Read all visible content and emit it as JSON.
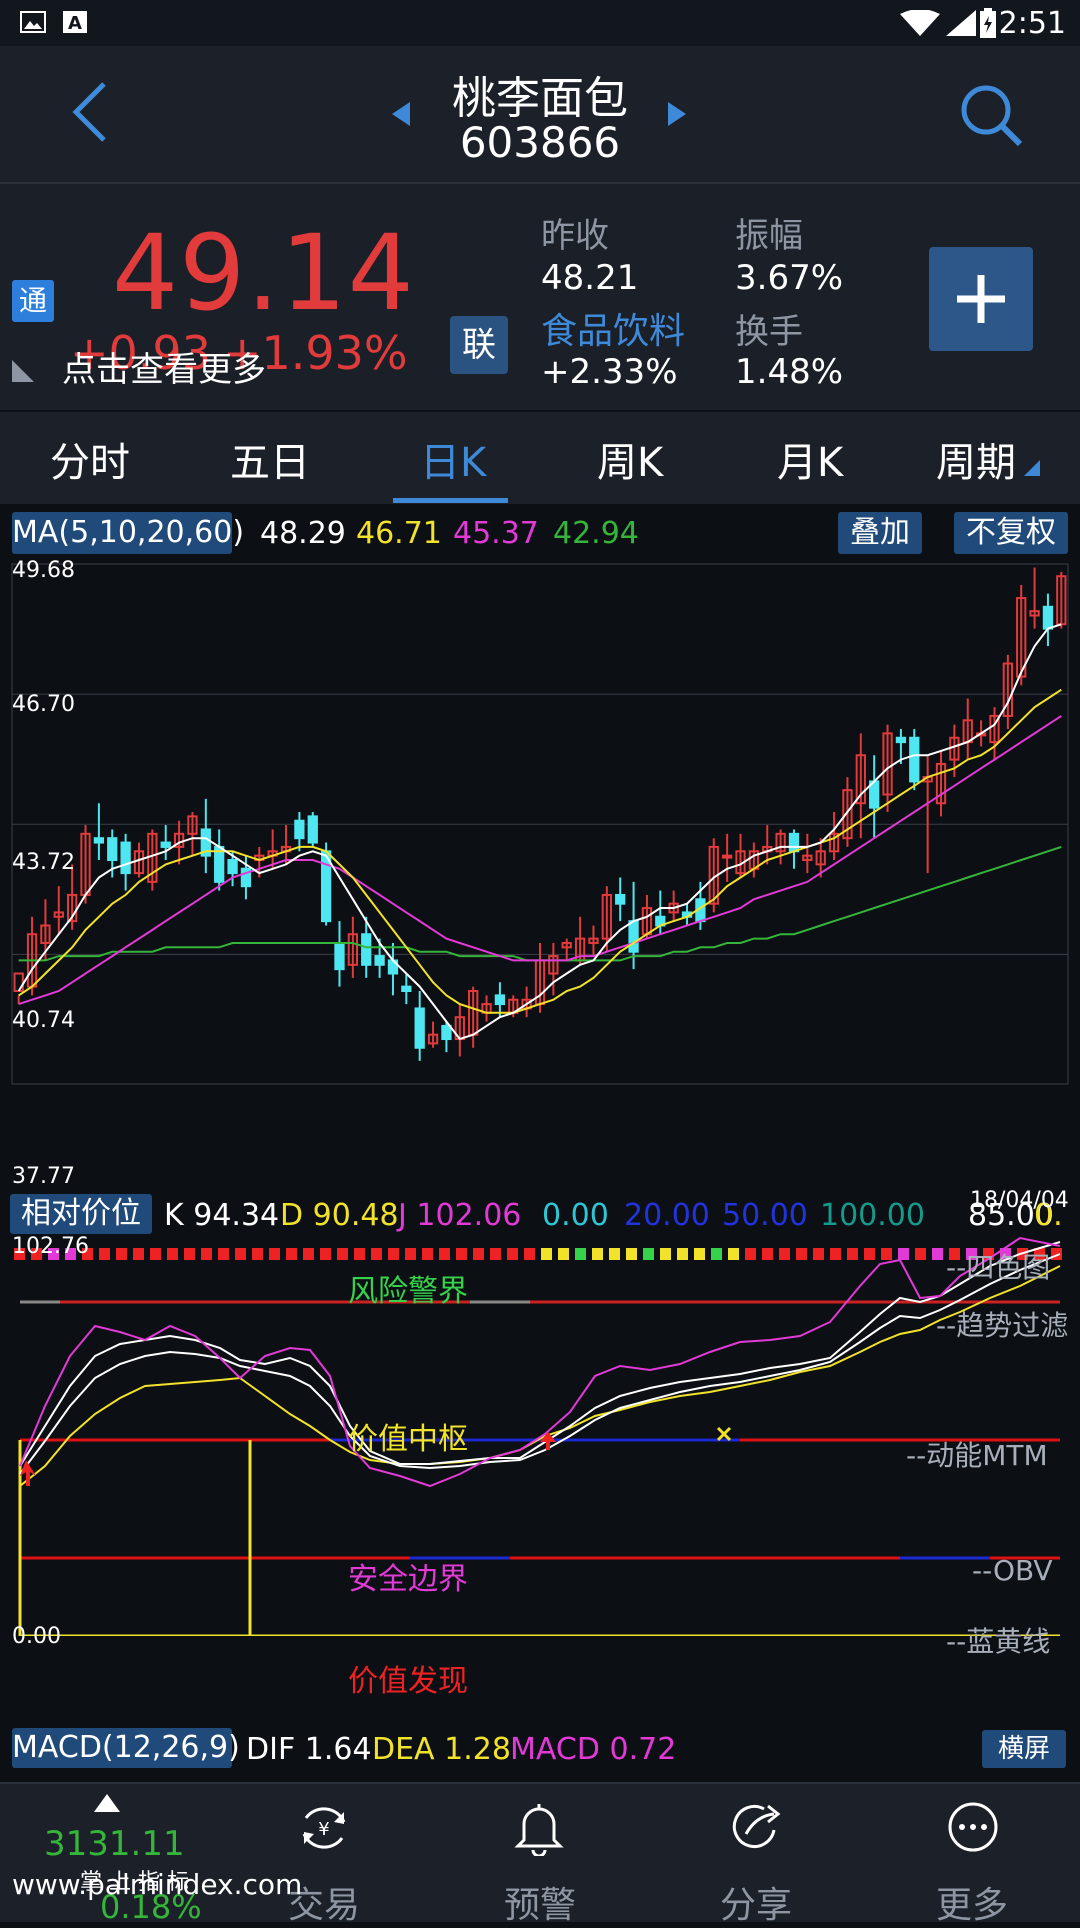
{
  "status": {
    "time": "2:51"
  },
  "header": {
    "title": "桃李面包",
    "code": "603866"
  },
  "quote": {
    "price": "49.14",
    "change": "+0.93",
    "change_pct": "+1.93%",
    "more_label": "点击查看更多",
    "tong_badge": "通",
    "lian_badge": "联",
    "prev_close_label": "昨收",
    "prev_close": "48.21",
    "sector_name": "食品饮料",
    "sector_change": "+2.33%",
    "amplitude_label": "振幅",
    "amplitude": "3.67%",
    "turnover_label": "换手",
    "turnover": "1.48%"
  },
  "tabs": [
    "分时",
    "五日",
    "日K",
    "周K",
    "月K",
    "周期"
  ],
  "active_tab": "日K",
  "ma": {
    "label": "MA(5,10,20,60)",
    "v5": "48.29",
    "v10": "46.71",
    "v20": "45.37",
    "v60": "42.94",
    "overlay_label": "叠加",
    "adjust_label": "不复权"
  },
  "price_axis": [
    "49.68",
    "46.70",
    "43.72",
    "40.74",
    "37.77"
  ],
  "indicator": {
    "name": "相对价位",
    "k_label": "K",
    "k": "94.34",
    "d_label": "D",
    "d": "90.48",
    "j_label": "J",
    "j": "102.06",
    "levels": [
      "0.00",
      "20.00",
      "50.00",
      "100.00",
      "85.00",
      "0."
    ],
    "date": "18/04/04",
    "top_value": "102.76",
    "bottom_value": "0.00",
    "zone_risk": "风险警界",
    "zone_center": "价值中枢",
    "zone_safe": "安全边界",
    "zone_discover": "价值发现",
    "r_sise": "--四色图",
    "r_trend": "--趋势过滤",
    "r_mtm": "--动能MTM",
    "r_obv": "--OBV",
    "r_lanhuang": "--蓝黄线"
  },
  "macd": {
    "label": "MACD(12,26,9)",
    "dif_label": "DIF",
    "dif": "1.64",
    "dea_label": "DEA",
    "dea": "1.28",
    "macd_label": "MACD",
    "macd": "0.72",
    "landscape_label": "横屏"
  },
  "nav": {
    "index_value": "3131.11",
    "index_pct": "0.18%",
    "index_caption": "掌 上 指 标",
    "trade": "交易",
    "alert": "预警",
    "share": "分享",
    "more": "更多"
  },
  "watermark": "www.palmindex.com",
  "colors": {
    "up": "#e23b3b",
    "down": "#4ee6f0",
    "accent": "#3f8ad8",
    "ma5": "#ffffff",
    "ma10": "#f2e32a",
    "ma20": "#e23ad6",
    "ma60": "#35b53a"
  },
  "chart_data": {
    "type": "candlestick",
    "ylim": [
      37.77,
      49.68
    ],
    "candles": [
      [
        39.9,
        40.3,
        39.8,
        39.6
      ],
      [
        40.0,
        41.2,
        41.6,
        39.8
      ],
      [
        41.0,
        41.4,
        42.0,
        40.6
      ],
      [
        41.6,
        41.7,
        42.3,
        41.2
      ],
      [
        41.5,
        42.1,
        42.8,
        41.3
      ],
      [
        42.1,
        43.5,
        43.7,
        41.9
      ],
      [
        43.4,
        43.3,
        44.2,
        42.9
      ],
      [
        43.4,
        42.9,
        43.6,
        42.5
      ],
      [
        43.3,
        42.6,
        43.5,
        42.2
      ],
      [
        42.6,
        43.1,
        43.3,
        42.5
      ],
      [
        42.4,
        43.5,
        43.6,
        42.2
      ],
      [
        43.3,
        43.2,
        43.7,
        42.9
      ],
      [
        43.2,
        43.5,
        43.8,
        42.8
      ],
      [
        43.5,
        43.9,
        44.0,
        43.0
      ],
      [
        43.6,
        43.0,
        44.3,
        42.6
      ],
      [
        43.2,
        42.4,
        43.6,
        42.2
      ],
      [
        42.9,
        42.6,
        43.1,
        42.3
      ],
      [
        42.7,
        42.3,
        43.0,
        42.0
      ],
      [
        42.9,
        43.0,
        43.2,
        42.5
      ],
      [
        43.0,
        43.1,
        43.6,
        42.7
      ],
      [
        43.1,
        43.2,
        43.7,
        42.8
      ],
      [
        43.8,
        43.4,
        44.0,
        43.1
      ],
      [
        43.9,
        43.3,
        44.0,
        43.2
      ],
      [
        43.1,
        41.5,
        43.3,
        41.4
      ],
      [
        41.0,
        40.4,
        41.5,
        40.0
      ],
      [
        40.5,
        41.2,
        41.6,
        40.2
      ],
      [
        41.2,
        40.5,
        41.6,
        40.2
      ],
      [
        40.7,
        40.5,
        41.1,
        40.2
      ],
      [
        40.6,
        40.3,
        41.0,
        39.8
      ],
      [
        40.0,
        39.9,
        40.3,
        39.6
      ],
      [
        39.5,
        38.6,
        39.9,
        38.3
      ],
      [
        38.7,
        38.9,
        39.2,
        38.6
      ],
      [
        39.1,
        38.8,
        39.2,
        38.5
      ],
      [
        38.8,
        39.3,
        39.6,
        38.4
      ],
      [
        38.9,
        39.9,
        40.0,
        38.6
      ],
      [
        39.4,
        39.6,
        39.8,
        39.2
      ],
      [
        39.8,
        39.6,
        40.1,
        39.3
      ],
      [
        39.4,
        39.7,
        39.8,
        39.3
      ],
      [
        39.5,
        39.7,
        40.0,
        39.3
      ],
      [
        39.6,
        40.6,
        41.0,
        39.4
      ],
      [
        40.3,
        40.7,
        41.0,
        39.8
      ],
      [
        40.9,
        41.0,
        41.1,
        40.6
      ],
      [
        40.6,
        41.1,
        41.6,
        40.5
      ],
      [
        41.0,
        41.1,
        41.4,
        40.7
      ],
      [
        41.1,
        42.1,
        42.3,
        40.8
      ],
      [
        42.1,
        41.9,
        42.5,
        41.5
      ],
      [
        41.5,
        40.8,
        42.4,
        40.4
      ],
      [
        41.2,
        41.8,
        42.1,
        41.1
      ],
      [
        41.6,
        41.4,
        42.2,
        41.2
      ],
      [
        41.7,
        41.9,
        42.2,
        41.5
      ],
      [
        41.7,
        41.6,
        41.9,
        41.4
      ],
      [
        42.0,
        41.5,
        42.4,
        41.3
      ],
      [
        41.9,
        43.2,
        43.4,
        41.7
      ],
      [
        43.0,
        43.0,
        43.5,
        42.4
      ],
      [
        42.6,
        43.1,
        43.5,
        42.5
      ],
      [
        42.7,
        43.1,
        43.3,
        42.5
      ],
      [
        43.1,
        43.2,
        43.7,
        42.8
      ],
      [
        43.1,
        43.5,
        43.6,
        42.8
      ],
      [
        43.5,
        43.1,
        43.6,
        42.7
      ],
      [
        42.9,
        43.0,
        43.5,
        42.6
      ],
      [
        42.8,
        43.1,
        43.4,
        42.5
      ],
      [
        43.1,
        43.5,
        44.0,
        42.9
      ],
      [
        43.4,
        44.5,
        44.8,
        43.2
      ],
      [
        44.2,
        45.3,
        45.8,
        43.4
      ],
      [
        44.7,
        44.1,
        45.3,
        43.4
      ],
      [
        44.4,
        45.8,
        46.0,
        44.0
      ],
      [
        45.7,
        45.6,
        45.9,
        45.1
      ],
      [
        45.7,
        44.7,
        45.9,
        44.5
      ],
      [
        44.7,
        44.8,
        45.3,
        42.6
      ],
      [
        44.2,
        45.1,
        45.4,
        43.9
      ],
      [
        45.2,
        45.7,
        46.0,
        44.8
      ],
      [
        45.6,
        46.1,
        46.6,
        45.2
      ],
      [
        45.8,
        45.8,
        46.1,
        45.5
      ],
      [
        45.6,
        46.2,
        46.4,
        45.2
      ],
      [
        46.2,
        47.4,
        47.6,
        45.9
      ],
      [
        47.1,
        48.9,
        49.2,
        46.9
      ],
      [
        48.5,
        48.6,
        49.6,
        48.2
      ],
      [
        48.7,
        48.2,
        49.0,
        47.8
      ],
      [
        48.3,
        49.4,
        49.5,
        48.2
      ]
    ],
    "ma5": [
      39.9,
      40.4,
      40.8,
      41.2,
      41.6,
      42.1,
      42.5,
      42.7,
      42.8,
      42.9,
      43.0,
      43.1,
      43.3,
      43.4,
      43.4,
      43.2,
      43.0,
      42.8,
      42.6,
      42.7,
      42.8,
      43.0,
      43.1,
      43.0,
      42.5,
      42.0,
      41.5,
      41.0,
      40.6,
      40.3,
      40.0,
      39.6,
      39.2,
      38.8,
      38.9,
      39.1,
      39.3,
      39.4,
      39.6,
      39.8,
      40.1,
      40.3,
      40.5,
      40.6,
      41.0,
      41.3,
      41.5,
      41.6,
      41.8,
      41.8,
      41.9,
      42.2,
      42.5,
      42.7,
      42.8,
      43.0,
      43.1,
      43.2,
      43.2,
      43.2,
      43.3,
      43.6,
      44.0,
      44.4,
      44.7,
      45.0,
      45.2,
      45.3,
      45.3,
      45.4,
      45.5,
      45.6,
      45.8,
      46.0,
      46.5,
      47.2,
      47.8,
      48.2,
      48.3
    ],
    "ma10": [
      39.8,
      40.0,
      40.3,
      40.6,
      40.9,
      41.3,
      41.6,
      41.9,
      42.1,
      42.4,
      42.6,
      42.8,
      42.9,
      43.0,
      43.1,
      43.1,
      43.1,
      43.0,
      42.9,
      43.0,
      43.1,
      43.2,
      43.2,
      43.1,
      42.8,
      42.5,
      42.1,
      41.7,
      41.3,
      40.9,
      40.5,
      40.1,
      39.8,
      39.6,
      39.5,
      39.4,
      39.4,
      39.4,
      39.5,
      39.6,
      39.7,
      39.9,
      40.0,
      40.2,
      40.5,
      40.8,
      41.0,
      41.2,
      41.4,
      41.5,
      41.6,
      41.8,
      42.0,
      42.3,
      42.5,
      42.7,
      42.9,
      43.0,
      43.1,
      43.2,
      43.3,
      43.4,
      43.6,
      43.8,
      44.0,
      44.2,
      44.4,
      44.6,
      44.8,
      44.9,
      45.0,
      45.2,
      45.3,
      45.5,
      45.8,
      46.1,
      46.4,
      46.6,
      46.8
    ],
    "ma20": [
      39.6,
      39.7,
      39.8,
      39.9,
      40.1,
      40.3,
      40.5,
      40.7,
      40.9,
      41.1,
      41.3,
      41.5,
      41.7,
      41.9,
      42.1,
      42.3,
      42.5,
      42.6,
      42.7,
      42.8,
      42.9,
      42.9,
      42.9,
      42.8,
      42.7,
      42.5,
      42.3,
      42.1,
      41.9,
      41.7,
      41.5,
      41.3,
      41.1,
      41.0,
      40.9,
      40.8,
      40.7,
      40.6,
      40.6,
      40.6,
      40.6,
      40.6,
      40.7,
      40.7,
      40.8,
      40.9,
      41.0,
      41.1,
      41.2,
      41.3,
      41.4,
      41.5,
      41.6,
      41.7,
      41.8,
      42.0,
      42.1,
      42.2,
      42.3,
      42.4,
      42.6,
      42.8,
      43.0,
      43.2,
      43.4,
      43.6,
      43.8,
      44.0,
      44.2,
      44.4,
      44.6,
      44.8,
      45.0,
      45.2,
      45.4,
      45.6,
      45.8,
      46.0,
      46.2
    ],
    "ma60": [
      40.6,
      40.6,
      40.6,
      40.7,
      40.7,
      40.7,
      40.7,
      40.8,
      40.8,
      40.8,
      40.8,
      40.9,
      40.9,
      40.9,
      40.9,
      40.9,
      41.0,
      41.0,
      41.0,
      41.0,
      41.0,
      41.0,
      41.0,
      41.0,
      41.0,
      41.0,
      40.9,
      40.9,
      40.9,
      40.9,
      40.8,
      40.8,
      40.8,
      40.7,
      40.7,
      40.7,
      40.7,
      40.7,
      40.6,
      40.6,
      40.6,
      40.6,
      40.6,
      40.6,
      40.6,
      40.6,
      40.7,
      40.7,
      40.7,
      40.8,
      40.8,
      40.9,
      40.9,
      41.0,
      41.0,
      41.1,
      41.1,
      41.2,
      41.2,
      41.3,
      41.4,
      41.5,
      41.6,
      41.7,
      41.8,
      41.9,
      42.0,
      42.1,
      42.2,
      42.3,
      42.4,
      42.5,
      42.6,
      42.7,
      42.8,
      42.9,
      43.0,
      43.1,
      43.2
    ]
  }
}
